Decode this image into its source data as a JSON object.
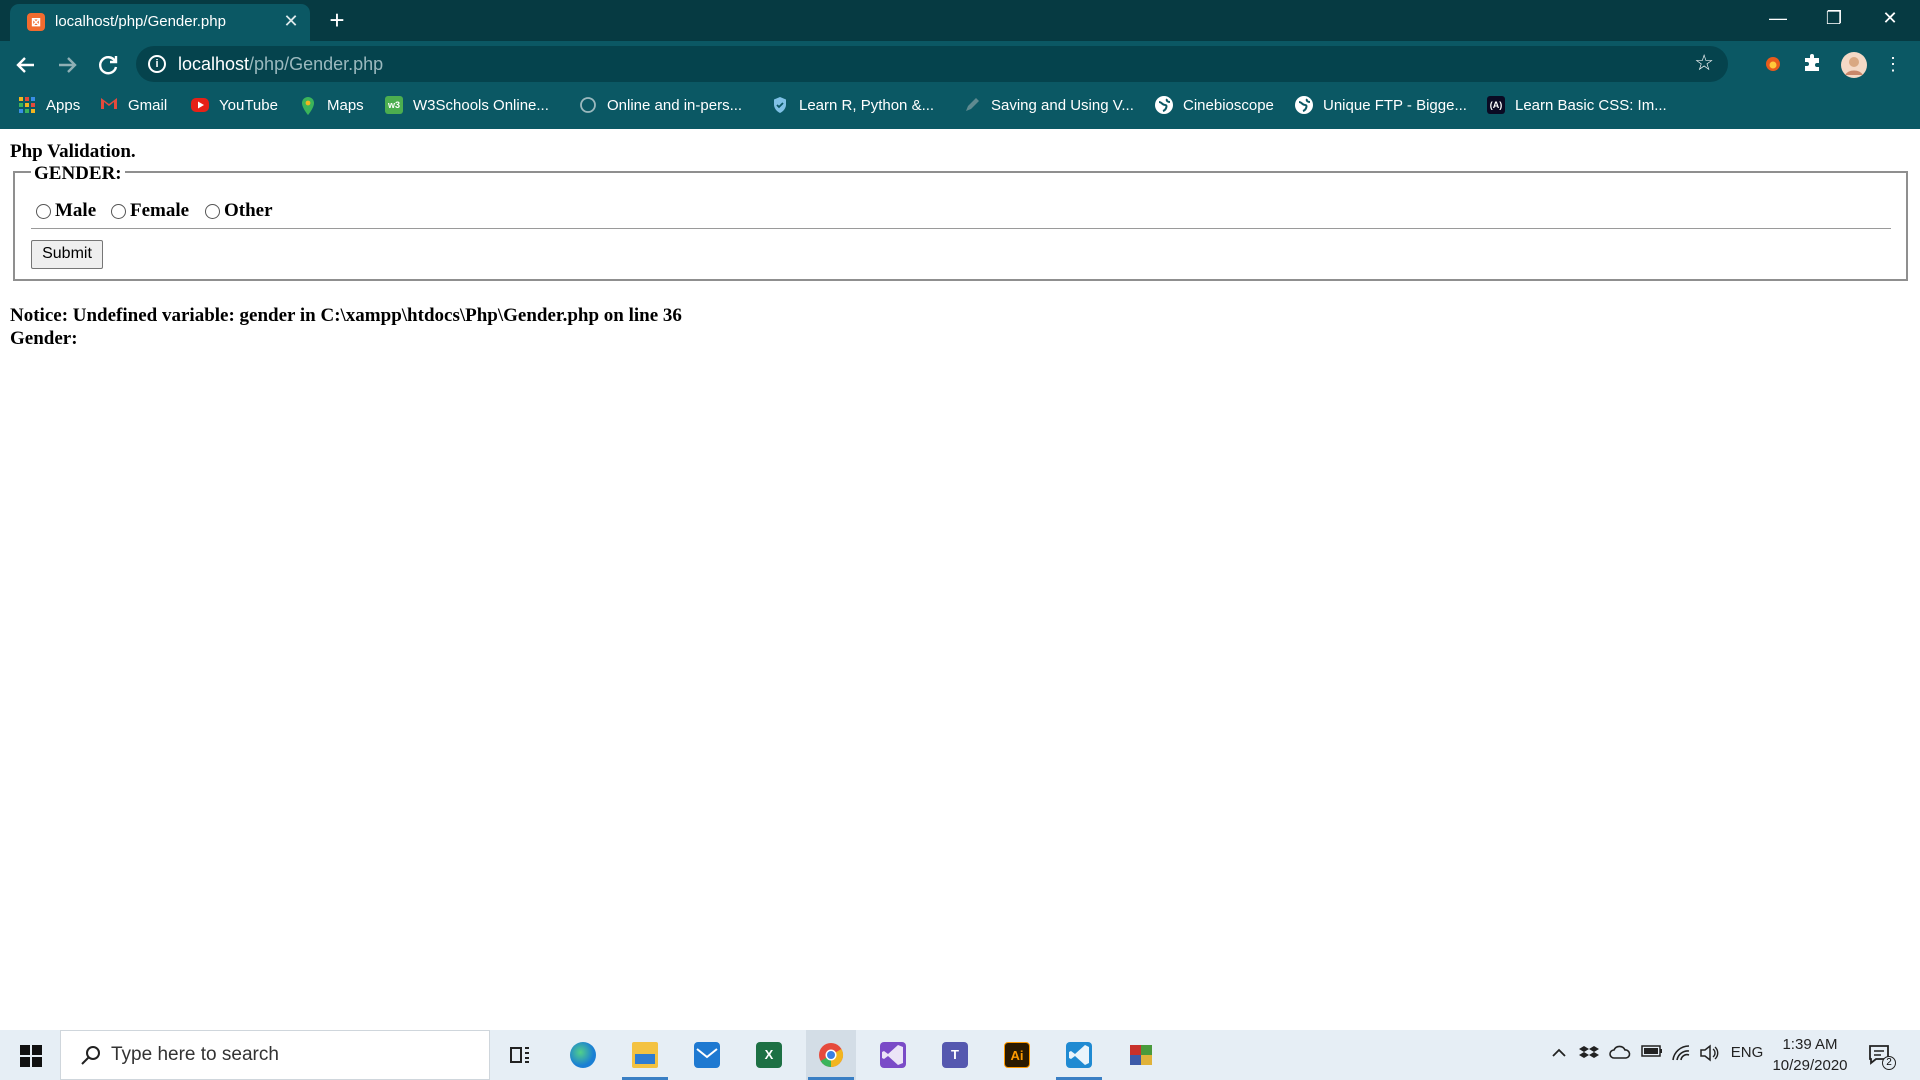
{
  "browser": {
    "tab_title": "localhost/php/Gender.php",
    "tab_close": "✕",
    "new_tab": "+",
    "url_host": "localhost",
    "url_path": "/php/Gender.php",
    "window_controls": {
      "minimize": "—",
      "restore": "❐",
      "close": "✕"
    },
    "accent_color": "#0b5864",
    "titlebar_color": "#063a42"
  },
  "bookmarks": [
    {
      "label": "Apps",
      "icon": "apps-grid-icon"
    },
    {
      "label": "Gmail",
      "icon": "gmail-icon"
    },
    {
      "label": "YouTube",
      "icon": "youtube-icon"
    },
    {
      "label": "Maps",
      "icon": "maps-icon"
    },
    {
      "label": "W3Schools Online...",
      "icon": "w3schools-icon"
    },
    {
      "label": "Online and in-pers...",
      "icon": "globe-icon"
    },
    {
      "label": "Learn R, Python &...",
      "icon": "shield-icon"
    },
    {
      "label": "Saving and Using V...",
      "icon": "pen-icon"
    },
    {
      "label": "Cinebioscope",
      "icon": "globe-icon"
    },
    {
      "label": "Unique FTP - Bigge...",
      "icon": "globe-icon"
    },
    {
      "label": "Learn Basic CSS: Im...",
      "icon": "freecodecamp-icon"
    }
  ],
  "page": {
    "heading": "Php Validation.",
    "legend": "GENDER:",
    "radios": [
      {
        "label": "Male",
        "checked": false
      },
      {
        "label": "Female",
        "checked": false
      },
      {
        "label": "Other",
        "checked": false
      }
    ],
    "submit_label": "Submit",
    "notice": "Notice: Undefined variable: gender in C:\\xampp\\htdocs\\Php\\Gender.php on line 36",
    "gender_output": "Gender:"
  },
  "taskbar": {
    "search_placeholder": "Type here to search",
    "apps": [
      {
        "name": "task-view",
        "icon": "task-view-icon"
      },
      {
        "name": "edge",
        "icon": "edge-icon"
      },
      {
        "name": "file-explorer",
        "icon": "folder-icon"
      },
      {
        "name": "mail",
        "icon": "mail-icon"
      },
      {
        "name": "excel",
        "icon": "excel-icon"
      },
      {
        "name": "chrome",
        "icon": "chrome-icon"
      },
      {
        "name": "visual-studio",
        "icon": "visual-studio-icon"
      },
      {
        "name": "teams",
        "icon": "teams-icon"
      },
      {
        "name": "illustrator",
        "icon": "illustrator-icon"
      },
      {
        "name": "vscode",
        "icon": "vscode-icon"
      },
      {
        "name": "winrar",
        "icon": "winrar-icon"
      }
    ],
    "language": "ENG",
    "time": "1:39 AM",
    "date": "10/29/2020",
    "notification_count": "2"
  }
}
